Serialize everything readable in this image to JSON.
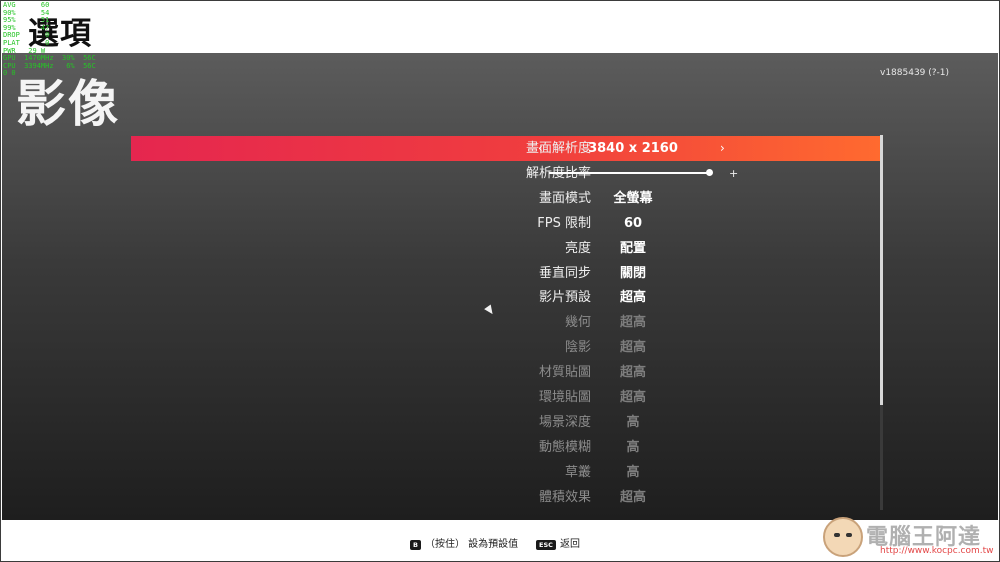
{
  "overlay_lines": [
    "AVG      60",
    "90%      54",
    "95%      51",
    "99%      47",
    "DROP      0",
    "PLAT      0",
    "PWR   29 W",
    "GPU  1470MHz  30%  56C",
    "CPU  3394MHz   6%  56C",
    "0 0"
  ],
  "header": {
    "title": "選項"
  },
  "version": "v1885439 (?-1)",
  "section": {
    "title": "影像"
  },
  "settings": [
    {
      "label": "畫面解析度",
      "value": "3840 x 2160",
      "type": "selector",
      "selected": true,
      "enabled": true
    },
    {
      "label": "解析度比率",
      "value": "",
      "type": "slider",
      "selected": false,
      "enabled": true,
      "slider_value": 1.0,
      "slider_minus": "-",
      "slider_plus": "+"
    },
    {
      "label": "畫面模式",
      "value": "全螢幕",
      "type": "selector",
      "selected": false,
      "enabled": true
    },
    {
      "label": "FPS 限制",
      "value": "60",
      "type": "selector",
      "selected": false,
      "enabled": true
    },
    {
      "label": "亮度",
      "value": "配置",
      "type": "selector",
      "selected": false,
      "enabled": true
    },
    {
      "label": "垂直同步",
      "value": "關閉",
      "type": "selector",
      "selected": false,
      "enabled": true
    },
    {
      "label": "影片預設",
      "value": "超高",
      "type": "selector",
      "selected": false,
      "enabled": true
    },
    {
      "label": "幾何",
      "value": "超高",
      "type": "selector",
      "selected": false,
      "enabled": false
    },
    {
      "label": "陰影",
      "value": "超高",
      "type": "selector",
      "selected": false,
      "enabled": false
    },
    {
      "label": "材質貼圖",
      "value": "超高",
      "type": "selector",
      "selected": false,
      "enabled": false
    },
    {
      "label": "環境貼圖",
      "value": "超高",
      "type": "selector",
      "selected": false,
      "enabled": false
    },
    {
      "label": "場景深度",
      "value": "高",
      "type": "selector",
      "selected": false,
      "enabled": false
    },
    {
      "label": "動態模糊",
      "value": "高",
      "type": "selector",
      "selected": false,
      "enabled": false
    },
    {
      "label": "草叢",
      "value": "高",
      "type": "selector",
      "selected": false,
      "enabled": false
    },
    {
      "label": "體積效果",
      "value": "超高",
      "type": "selector",
      "selected": false,
      "enabled": false
    }
  ],
  "arrows": {
    "left": "‹",
    "right": "›"
  },
  "scrollbar": {
    "visible_fraction": 0.72,
    "position": 0.0
  },
  "footer": {
    "reset_key": "B",
    "reset_label": "（按住） 設為預設值",
    "back_key": "ESC",
    "back_label": "返回"
  },
  "watermark": {
    "text": "電腦王阿達",
    "url": "http://www.kocpc.com.tw"
  },
  "colors": {
    "selected_start": "#e5264f",
    "selected_end": "#ff6a2f",
    "overlay_text": "#26c426"
  }
}
